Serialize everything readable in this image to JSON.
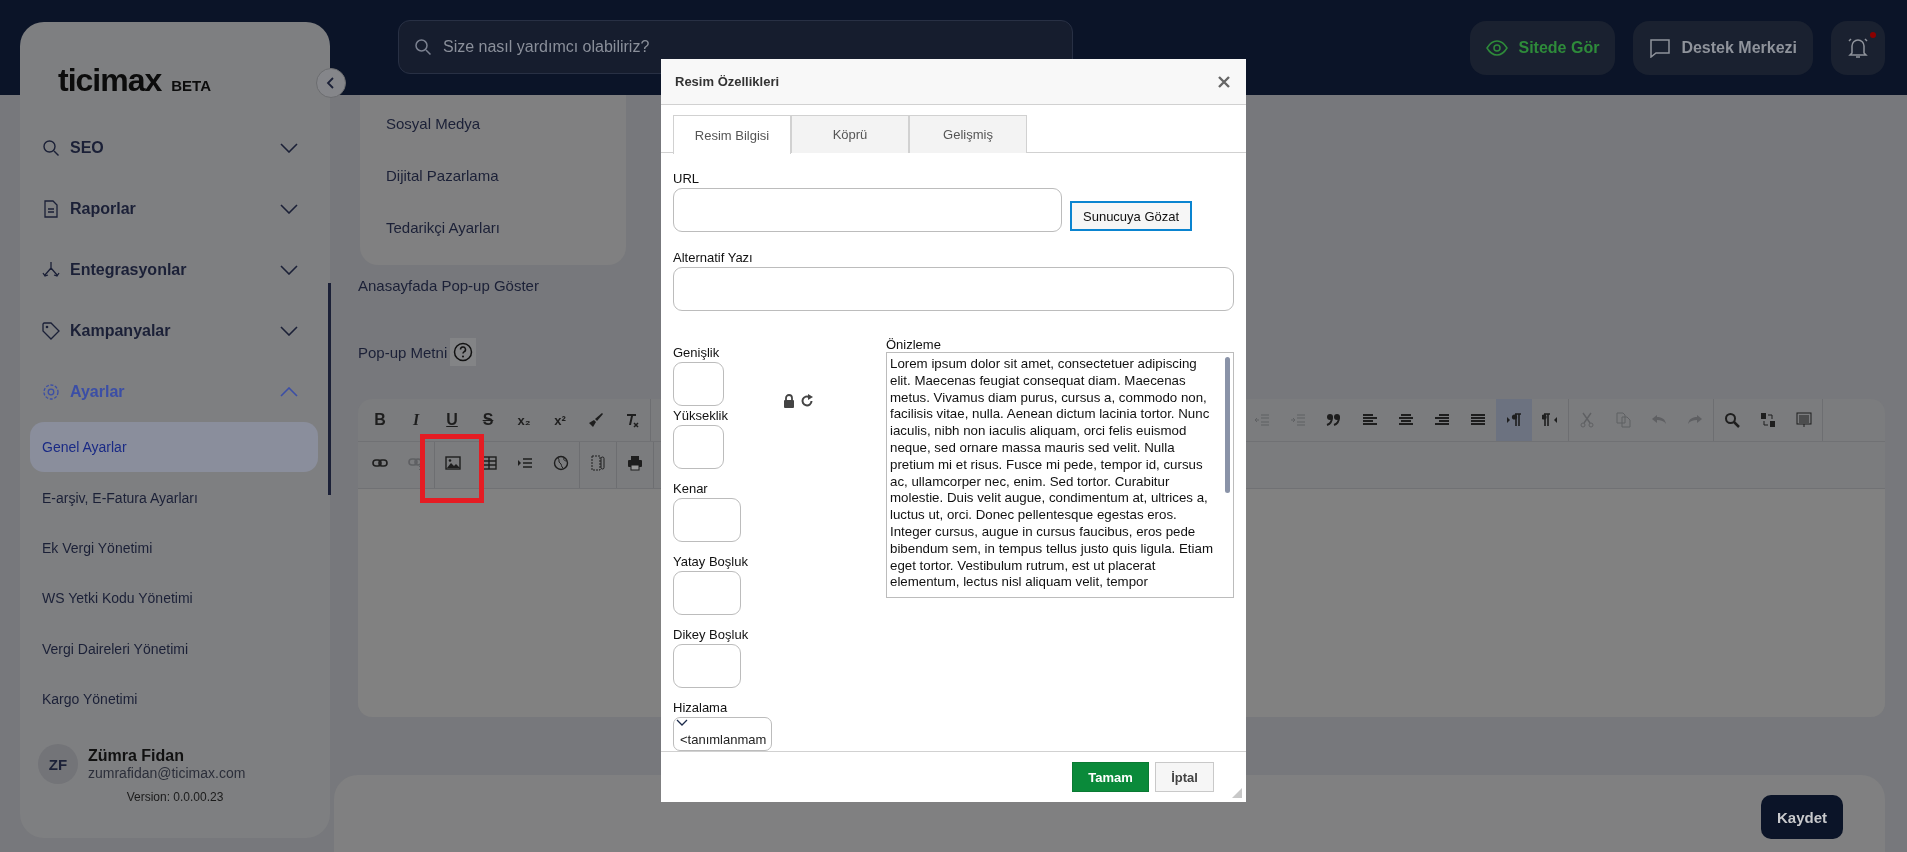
{
  "topbar": {
    "search": {
      "placeholder": "Size nasıl yardımcı olabiliriz?"
    },
    "buttons": [
      {
        "label": "Sitede Gör",
        "kind": "view"
      },
      {
        "label": "Destek Merkezi",
        "kind": "support"
      }
    ],
    "notifications": {
      "unread": true
    }
  },
  "sidebar": {
    "logo": "ticimax",
    "badge": "BETA",
    "items": [
      {
        "label": "SEO",
        "expanded": false
      },
      {
        "label": "Raporlar",
        "expanded": false
      },
      {
        "label": "Entegrasyonlar",
        "expanded": false
      },
      {
        "label": "Kampanyalar",
        "expanded": false
      },
      {
        "label": "Ayarlar",
        "expanded": true,
        "children": [
          {
            "label": "Genel Ayarlar",
            "selected": true
          },
          {
            "label": "E-arşiv, E-Fatura Ayarları",
            "selected": false
          },
          {
            "label": "Ek Vergi Yönetimi",
            "selected": false
          },
          {
            "label": "WS Yetki Kodu Yönetimi",
            "selected": false
          },
          {
            "label": "Vergi Daireleri Yönetimi",
            "selected": false
          },
          {
            "label": "Kargo Yönetimi",
            "selected": false
          }
        ]
      }
    ],
    "user": {
      "initials": "ZF",
      "name": "Zümra Fidan",
      "email": "zumrafidan@ticimax.com"
    },
    "version": "Version: 0.0.00.23"
  },
  "menu": {
    "items": [
      "Sosyal Medya",
      "Dijital Pazarlama",
      "Tedarikçi Ayarları"
    ]
  },
  "form": {
    "popup_toggle_label": "Anasayfada Pop-up Göster",
    "popup_text_label": "Pop-up Metni"
  },
  "editor": {
    "toolbar": {
      "row_1_left": [
        [
          {
            "kind": "glyph",
            "label": "B",
            "disabled": false,
            "on": false
          },
          {
            "kind": "glyph",
            "label": "I",
            "disabled": false,
            "on": false
          },
          {
            "kind": "glyph",
            "label": "U",
            "disabled": false,
            "on": false
          },
          {
            "kind": "glyph",
            "label": "S",
            "disabled": false,
            "on": false
          },
          {
            "kind": "glyph",
            "label": "x₂",
            "disabled": false,
            "on": false
          },
          {
            "kind": "glyph",
            "label": "x²",
            "disabled": false,
            "on": false
          },
          {
            "kind": "icon",
            "disabled": false,
            "on": false
          },
          {
            "kind": "icon",
            "disabled": false,
            "on": false
          }
        ]
      ],
      "row_1_right": [
        [
          {
            "kind": "icon",
            "disabled": true,
            "on": false
          },
          {
            "kind": "icon",
            "disabled": true,
            "on": false
          },
          {
            "kind": "icon",
            "disabled": false,
            "on": false
          },
          {
            "kind": "icon",
            "disabled": false,
            "on": false
          },
          {
            "kind": "icon",
            "disabled": false,
            "on": false
          },
          {
            "kind": "icon",
            "disabled": false,
            "on": false
          },
          {
            "kind": "icon",
            "disabled": false,
            "on": false
          },
          {
            "kind": "icon",
            "disabled": false,
            "on": true
          },
          {
            "kind": "icon",
            "disabled": false,
            "on": false
          }
        ],
        [
          {
            "kind": "icon",
            "disabled": true,
            "on": false
          },
          {
            "kind": "icon",
            "disabled": true,
            "on": false
          },
          {
            "kind": "icon",
            "disabled": true,
            "on": false
          },
          {
            "kind": "icon",
            "disabled": true,
            "on": false
          }
        ],
        [
          {
            "kind": "icon",
            "disabled": false,
            "on": false
          },
          {
            "kind": "icon",
            "disabled": false,
            "on": false
          },
          {
            "kind": "icon",
            "disabled": false,
            "on": false
          }
        ]
      ],
      "row_2": [
        [
          {
            "kind": "icon",
            "disabled": false,
            "on": false
          },
          {
            "kind": "icon",
            "disabled": true,
            "on": false
          }
        ],
        [
          {
            "kind": "icon",
            "disabled": false,
            "on": false
          },
          {
            "kind": "icon",
            "disabled": false,
            "on": false
          },
          {
            "kind": "icon",
            "disabled": false,
            "on": false
          },
          {
            "kind": "icon",
            "disabled": false,
            "on": false
          }
        ],
        [
          {
            "kind": "icon",
            "disabled": false,
            "on": false
          }
        ],
        [
          {
            "kind": "icon",
            "disabled": false,
            "on": false
          }
        ]
      ]
    }
  },
  "save_button": "Kaydet",
  "dialog": {
    "title": "Resim Özellikleri",
    "tabs": [
      {
        "label": "Resim Bilgisi",
        "selected": true
      },
      {
        "label": "Köprü",
        "selected": false
      },
      {
        "label": "Gelişmiş",
        "selected": false
      }
    ],
    "url": {
      "label": "URL"
    },
    "browse_button": "Sunucuya Gözat",
    "alt_text": {
      "label": "Alternatif Yazı"
    },
    "size_fields": [
      {
        "label": "Genişlik"
      },
      {
        "label": "Yükseklik"
      }
    ],
    "spacing_fields": [
      {
        "label": "Kenar"
      },
      {
        "label": "Yatay Boşluk"
      },
      {
        "label": "Dikey Boşluk"
      }
    ],
    "align": {
      "label": "Hizalama",
      "value": "<tanımlanmam"
    },
    "preview": {
      "label": "Önizleme",
      "text": "Lorem ipsum dolor sit amet, consectetuer adipiscing elit. Maecenas feugiat consequat diam. Maecenas metus. Vivamus diam purus, cursus a, commodo non, facilisis vitae, nulla. Aenean dictum lacinia tortor. Nunc iaculis, nibh non iaculis aliquam, orci felis euismod neque, sed ornare massa mauris sed velit. Nulla pretium mi et risus. Fusce mi pede, tempor id, cursus ac, ullamcorper nec, enim. Sed tortor. Curabitur molestie. Duis velit augue, condimentum at, ultrices a, luctus ut, orci. Donec pellentesque egestas eros. Integer cursus, augue in cursus faucibus, eros pede bibendum sem, in tempus tellus justo quis ligula. Etiam eget tortor. Vestibulum rutrum, est ut placerat elementum, lectus nisl aliquam velit, tempor"
    },
    "buttons": [
      {
        "label": "Tamam",
        "kind": "primary"
      },
      {
        "label": "İptal",
        "kind": "secondary"
      }
    ]
  }
}
